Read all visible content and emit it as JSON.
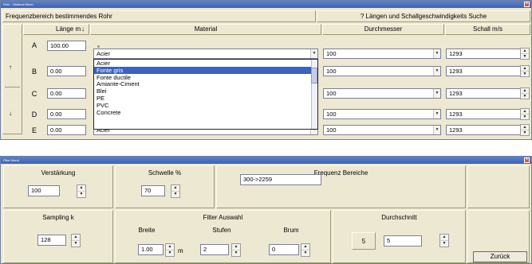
{
  "window1": {
    "title": "Rohr - Material Menü",
    "header_left": "Frequenzbereich bestimmendes Rohr",
    "header_right": "? Längen und Schallgeschwindigkeits Suche",
    "col_laenge": "Länge m",
    "sort_arrow": "↓",
    "col_material": "Material",
    "col_durchmesser": "Durchmesser",
    "col_schall": "Schall m/s",
    "up_arrow": "↑",
    "down_arrow": "↓",
    "rows": [
      {
        "letter": "A",
        "length": "100.00",
        "material": "Acier",
        "diameter": "100",
        "speed": "1293"
      },
      {
        "letter": "B",
        "length": "0.00",
        "material": "",
        "diameter": "100",
        "speed": "1293"
      },
      {
        "letter": "C",
        "length": "0.00",
        "material": "",
        "diameter": "100",
        "speed": "1293"
      },
      {
        "letter": "D",
        "length": "0.00",
        "material": "",
        "diameter": "100",
        "speed": "1293"
      },
      {
        "letter": "E",
        "length": "0.00",
        "material": "Acier",
        "diameter": "100",
        "speed": "1293"
      }
    ],
    "dropdown_items": [
      "Acier",
      "Fonte gris",
      "Fonte ductile",
      "Amiante-Ciment",
      "Blei",
      "PE",
      "PVC",
      "Concrete"
    ],
    "dropdown_selected": "Fonte gris"
  },
  "window2": {
    "title": "Filter Menü",
    "verstaerkung_label": "Verstärkung",
    "verstaerkung_value": "100",
    "schwelle_label": "Schwelle %",
    "schwelle_value": "70",
    "frequenz_label": "Frequenz Bereiche",
    "frequenz_value": "300->2259",
    "sampling_label": "Sampling k",
    "sampling_value": "128",
    "filter_label": "Filter Auswahl",
    "breite_label": "Breite",
    "breite_value": "1.00",
    "breite_unit": "m",
    "stufen_label": "Stufen",
    "stufen_value": "2",
    "brum_label": "Brum",
    "brum_value": "0",
    "durchschnitt_label": "Durchschnitt",
    "durchschnitt_display": "5",
    "durchschnitt_value": "5",
    "zurueck_label": "Zurück"
  }
}
